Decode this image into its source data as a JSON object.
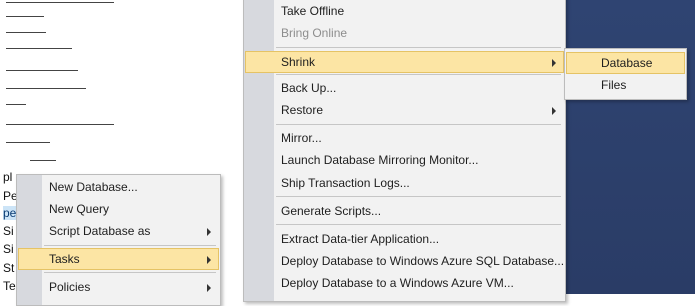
{
  "tree": {
    "items": [
      "pl",
      "Pe",
      "pe",
      "Si",
      "Si",
      "St",
      "Te"
    ]
  },
  "tasks_menu": {
    "items": [
      {
        "label": "Take Offline"
      },
      {
        "label": "Bring Online"
      },
      {
        "label": "Shrink"
      },
      {
        "label": "Back Up..."
      },
      {
        "label": "Restore"
      },
      {
        "label": "Mirror..."
      },
      {
        "label": "Launch Database Mirroring Monitor..."
      },
      {
        "label": "Ship Transaction Logs..."
      },
      {
        "label": "Generate Scripts..."
      },
      {
        "label": "Extract Data-tier Application..."
      },
      {
        "label": "Deploy Database to Windows Azure SQL Database..."
      },
      {
        "label": "Deploy Database to a Windows Azure VM..."
      }
    ]
  },
  "context_menu": {
    "items": [
      {
        "label": "New Database..."
      },
      {
        "label": "New Query"
      },
      {
        "label": "Script Database as"
      },
      {
        "label": "Tasks"
      },
      {
        "label": "Policies"
      }
    ]
  },
  "shrink_menu": {
    "items": [
      {
        "label": "Database"
      },
      {
        "label": "Files"
      }
    ]
  },
  "colors": {
    "highlight": "#fce5a4",
    "highlight_border": "#e5c365",
    "menu_bg": "#f2f2f2",
    "gutter": "#d7d9de",
    "desktop": "#2b3e6a"
  }
}
